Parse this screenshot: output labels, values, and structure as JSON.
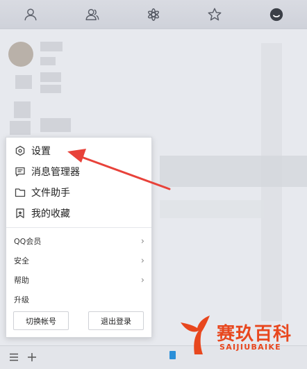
{
  "tabs": [
    {
      "icon": "contacts-icon"
    },
    {
      "icon": "groups-icon"
    },
    {
      "icon": "apps-icon"
    },
    {
      "icon": "favorites-star-icon"
    },
    {
      "icon": "messages-icon",
      "active": true
    }
  ],
  "menu": {
    "primary_items": [
      {
        "icon": "settings-hexagon-icon",
        "label": "设置"
      },
      {
        "icon": "message-manager-icon",
        "label": "消息管理器"
      },
      {
        "icon": "folder-icon",
        "label": "文件助手"
      },
      {
        "icon": "bookmark-icon",
        "label": "我的收藏"
      }
    ],
    "secondary_items": [
      {
        "label": "QQ会员",
        "has_submenu": true
      },
      {
        "label": "安全",
        "has_submenu": true
      },
      {
        "label": "帮助",
        "has_submenu": true
      },
      {
        "label": "升级",
        "has_submenu": false
      }
    ],
    "switch_account_label": "切换帐号",
    "logout_label": "退出登录"
  },
  "bottom_bar": {
    "menu_icon": "hamburger-menu-icon",
    "add_icon": "plus-icon"
  },
  "watermark": {
    "name": "赛玖百科",
    "sub": "SAIJIUBAIKE"
  },
  "colors": {
    "annotation_arrow": "#e8423a",
    "watermark": "#e8471e",
    "checkbox": "#2b8fd8"
  }
}
